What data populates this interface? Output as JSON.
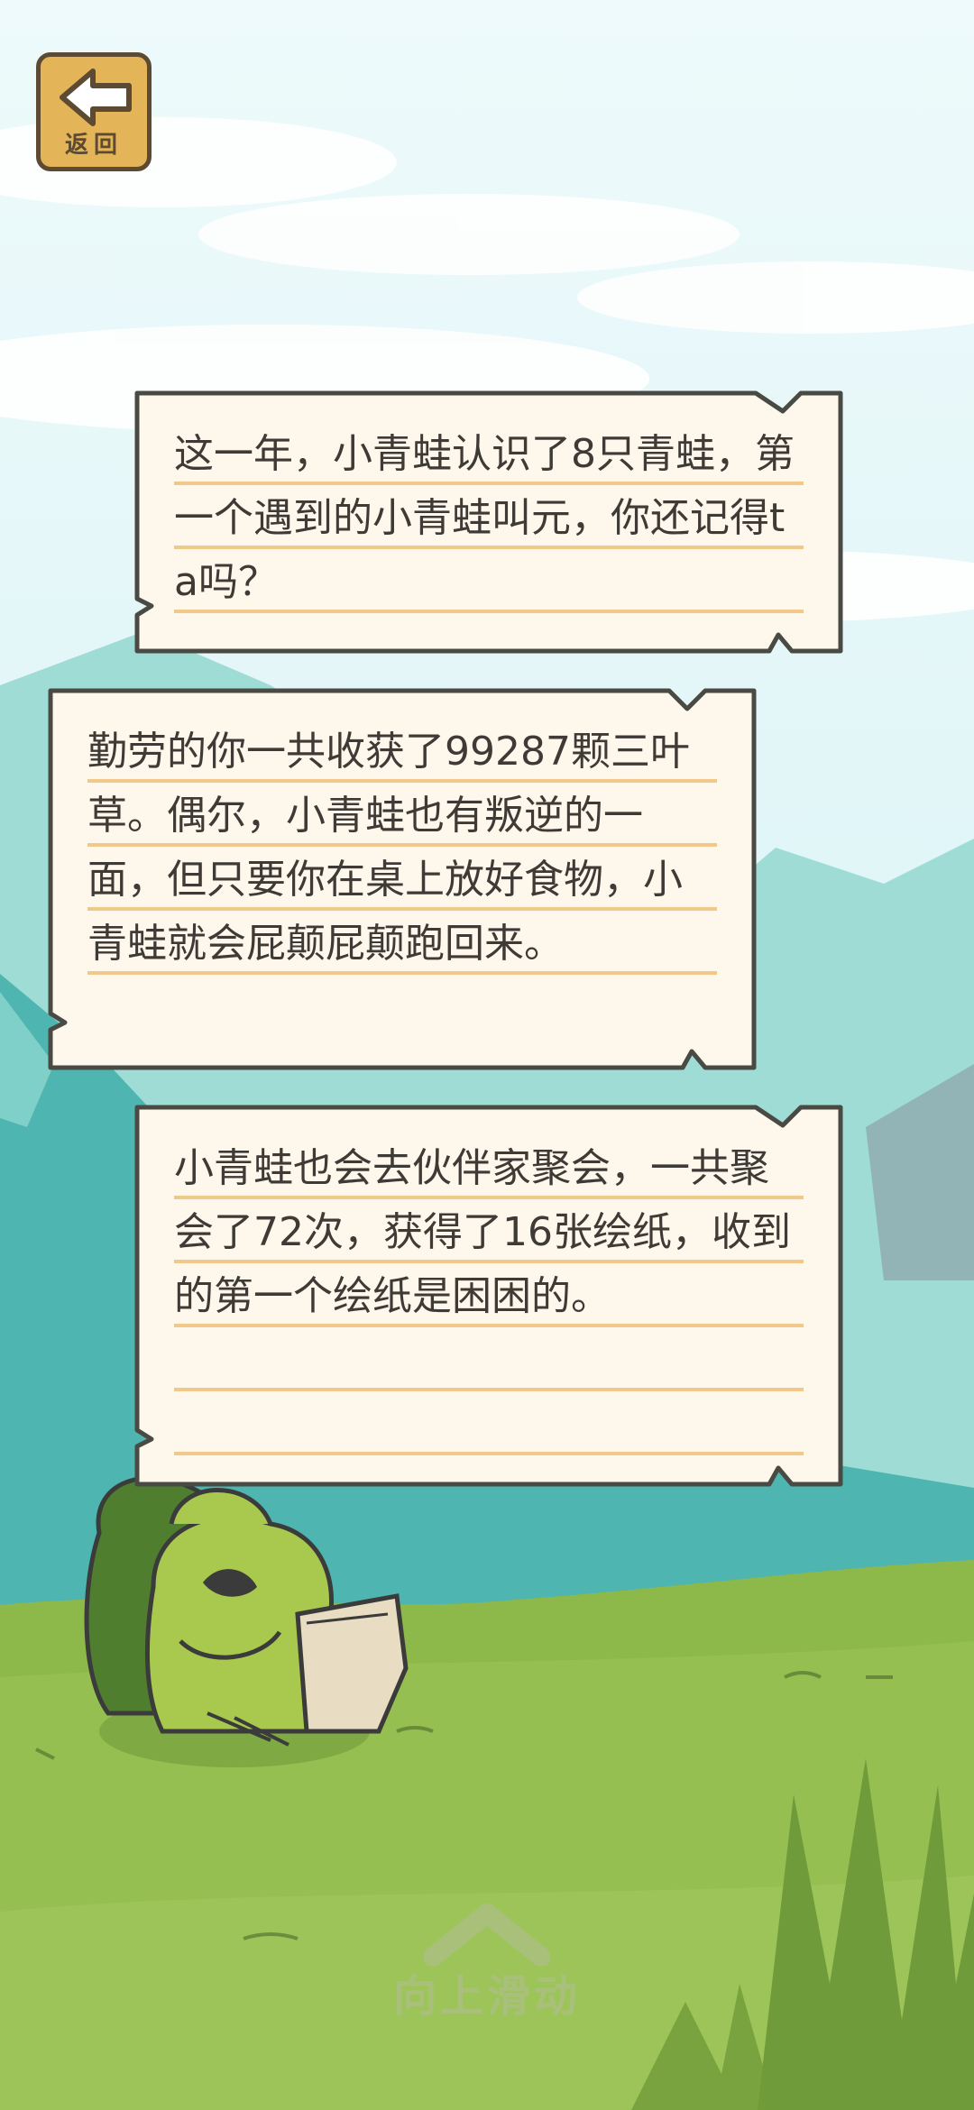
{
  "back_button": {
    "label": "返回",
    "icon": "back-arrow-icon"
  },
  "cards": [
    {
      "text": "这一年，小青蛙认识了8只青蛙，第一个遇到的小青蛙叫元，你还记得ta吗？"
    },
    {
      "text": "勤劳的你一共收获了99287颗三叶草。偶尔，小青蛙也有叛逆的一面，但只要你在桌上放好食物，小青蛙就会屁颠屁颠跑回来。"
    },
    {
      "text": "小青蛙也会去伙伴家聚会，一共聚会了72次，获得了16张绘纸，收到的第一个绘纸是困困的。"
    }
  ],
  "swipe_hint": {
    "label": "向上滑动",
    "icon": "chevron-up-icon"
  },
  "colors": {
    "sky": "#dff5f8",
    "grass": "#8db84a",
    "mountain": "#6fc7c0",
    "card": "#fdf7ec",
    "line": "#f0c98a"
  }
}
